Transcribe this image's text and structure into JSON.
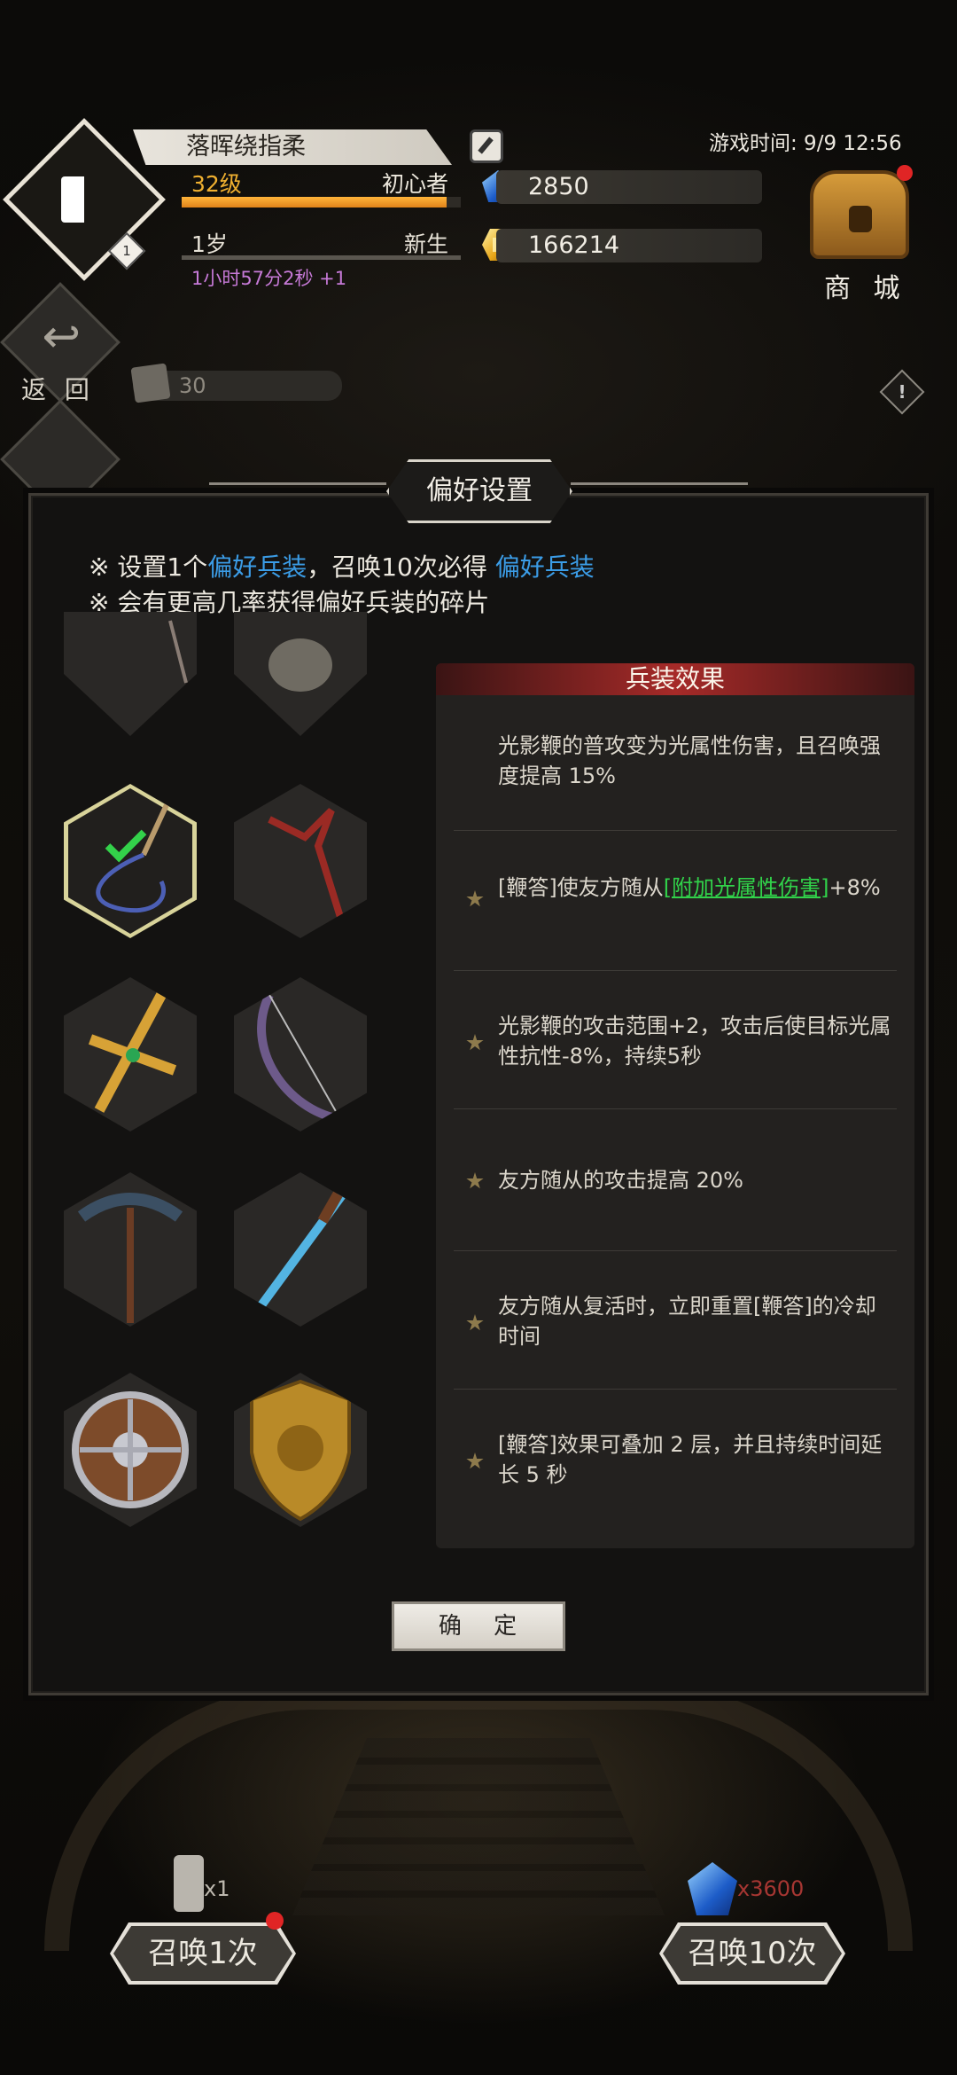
{
  "header": {
    "player_name": "落晖绕指柔",
    "rank_badge": "1",
    "level": "32级",
    "title": "初心者",
    "xp_progress": 0.95,
    "age": "1岁",
    "age_stage": "新生",
    "timer": "1小时57分2秒 +1",
    "game_time": "游戏时间: 9/9 12:56",
    "gems": "2850",
    "gold": "166214",
    "shop_label": "商 城",
    "back_label": "返 回",
    "scroll_count": "30"
  },
  "modal": {
    "title": "偏好设置",
    "info1_prefix": "※  设置1个",
    "info1_hl1": "偏好兵装",
    "info1_mid": "，召唤10次必得 ",
    "info1_hl2": "偏好兵装",
    "info2": "※  会有更高几率获得偏好兵装的碎片",
    "effects_header": "兵装效果",
    "effects": [
      {
        "star": false,
        "text": "光影鞭的普攻变为光属性伤害，且召唤强度提高 15%"
      },
      {
        "star": true,
        "text_pre": "[鞭答]使友方随从",
        "link": "[附加光属性伤害]",
        "text_post": "+8%"
      },
      {
        "star": true,
        "text": "光影鞭的攻击范围+2，攻击后使目标光属性抗性-8%，持续5秒"
      },
      {
        "star": true,
        "text": "友方随从的攻击提高 20%"
      },
      {
        "star": true,
        "text": "友方随从复活时，立即重置[鞭答]的冷却时间"
      },
      {
        "star": true,
        "text": "[鞭答]效果可叠加 2 层，并且持续时间延长 5 秒"
      }
    ],
    "weapons": [
      {
        "name": "whip-icon",
        "selected": true
      },
      {
        "name": "dragon-staff-icon",
        "selected": false
      },
      {
        "name": "golden-cross-sword-icon",
        "selected": false
      },
      {
        "name": "bow-icon",
        "selected": false
      },
      {
        "name": "spiked-mace-icon",
        "selected": false
      },
      {
        "name": "blue-rifle-icon",
        "selected": false
      },
      {
        "name": "round-shield-icon",
        "selected": false
      },
      {
        "name": "lion-shield-icon",
        "selected": false
      }
    ],
    "confirm_label": "确 定"
  },
  "summon": {
    "once_label": "召唤1次",
    "once_cost": "x1",
    "ten_label": "召唤10次",
    "ten_cost": "x3600"
  },
  "colors": {
    "highlight_blue": "#3b9ce6",
    "link_green": "#31d24a",
    "level_orange": "#f0b030",
    "timer_purple": "#c77ad8",
    "effect_header_red": "#a62a28"
  }
}
